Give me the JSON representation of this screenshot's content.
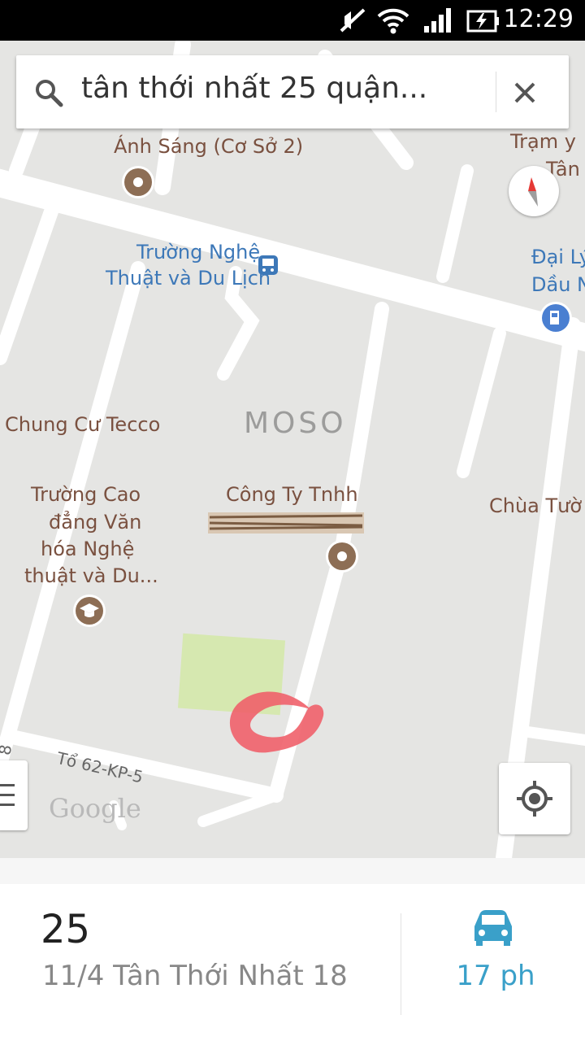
{
  "status_bar": {
    "time": "12:29",
    "icons": [
      "mute-icon",
      "wifi-icon",
      "signal-icon",
      "battery-charging-icon"
    ]
  },
  "search": {
    "query": "tân thới nhất 25 quận...",
    "icon": "search-icon",
    "clear_icon": "close-icon"
  },
  "map": {
    "labels": {
      "anh_sang": "Ánh Sáng (Cơ Sở 2)",
      "tram_y_1": "Trạm y",
      "tram_y_2": "Tân",
      "truong_nghe_1": "Trường Nghệ",
      "truong_nghe_2": "Thuật và Du Lịch",
      "dai_ly_1": "Đại Lý",
      "dai_ly_2": "Dầu N",
      "chung_cu": "Chung Cư Tecco",
      "truong_cao_1": "Trường Cao",
      "truong_cao_2": "đẳng Văn",
      "truong_cao_3": "hóa Nghệ",
      "truong_cao_4": "thuật và Du...",
      "cong_ty": "Công Ty Tnhh",
      "chua": "Chùa Tườ",
      "street": "Tổ 62-KP-5",
      "edge_num": "8"
    },
    "watermark": "MOSO",
    "attribution": "Google"
  },
  "place": {
    "title": "25",
    "address": "11/4 Tân Thới Nhất 18",
    "eta": "17 ph"
  },
  "colors": {
    "accent": "#3aa0c9",
    "poi_brown": "#8d6e55",
    "poi_blue": "#3d78b8",
    "marker_red": "#f0606a",
    "park_green": "#d6e8b0"
  }
}
